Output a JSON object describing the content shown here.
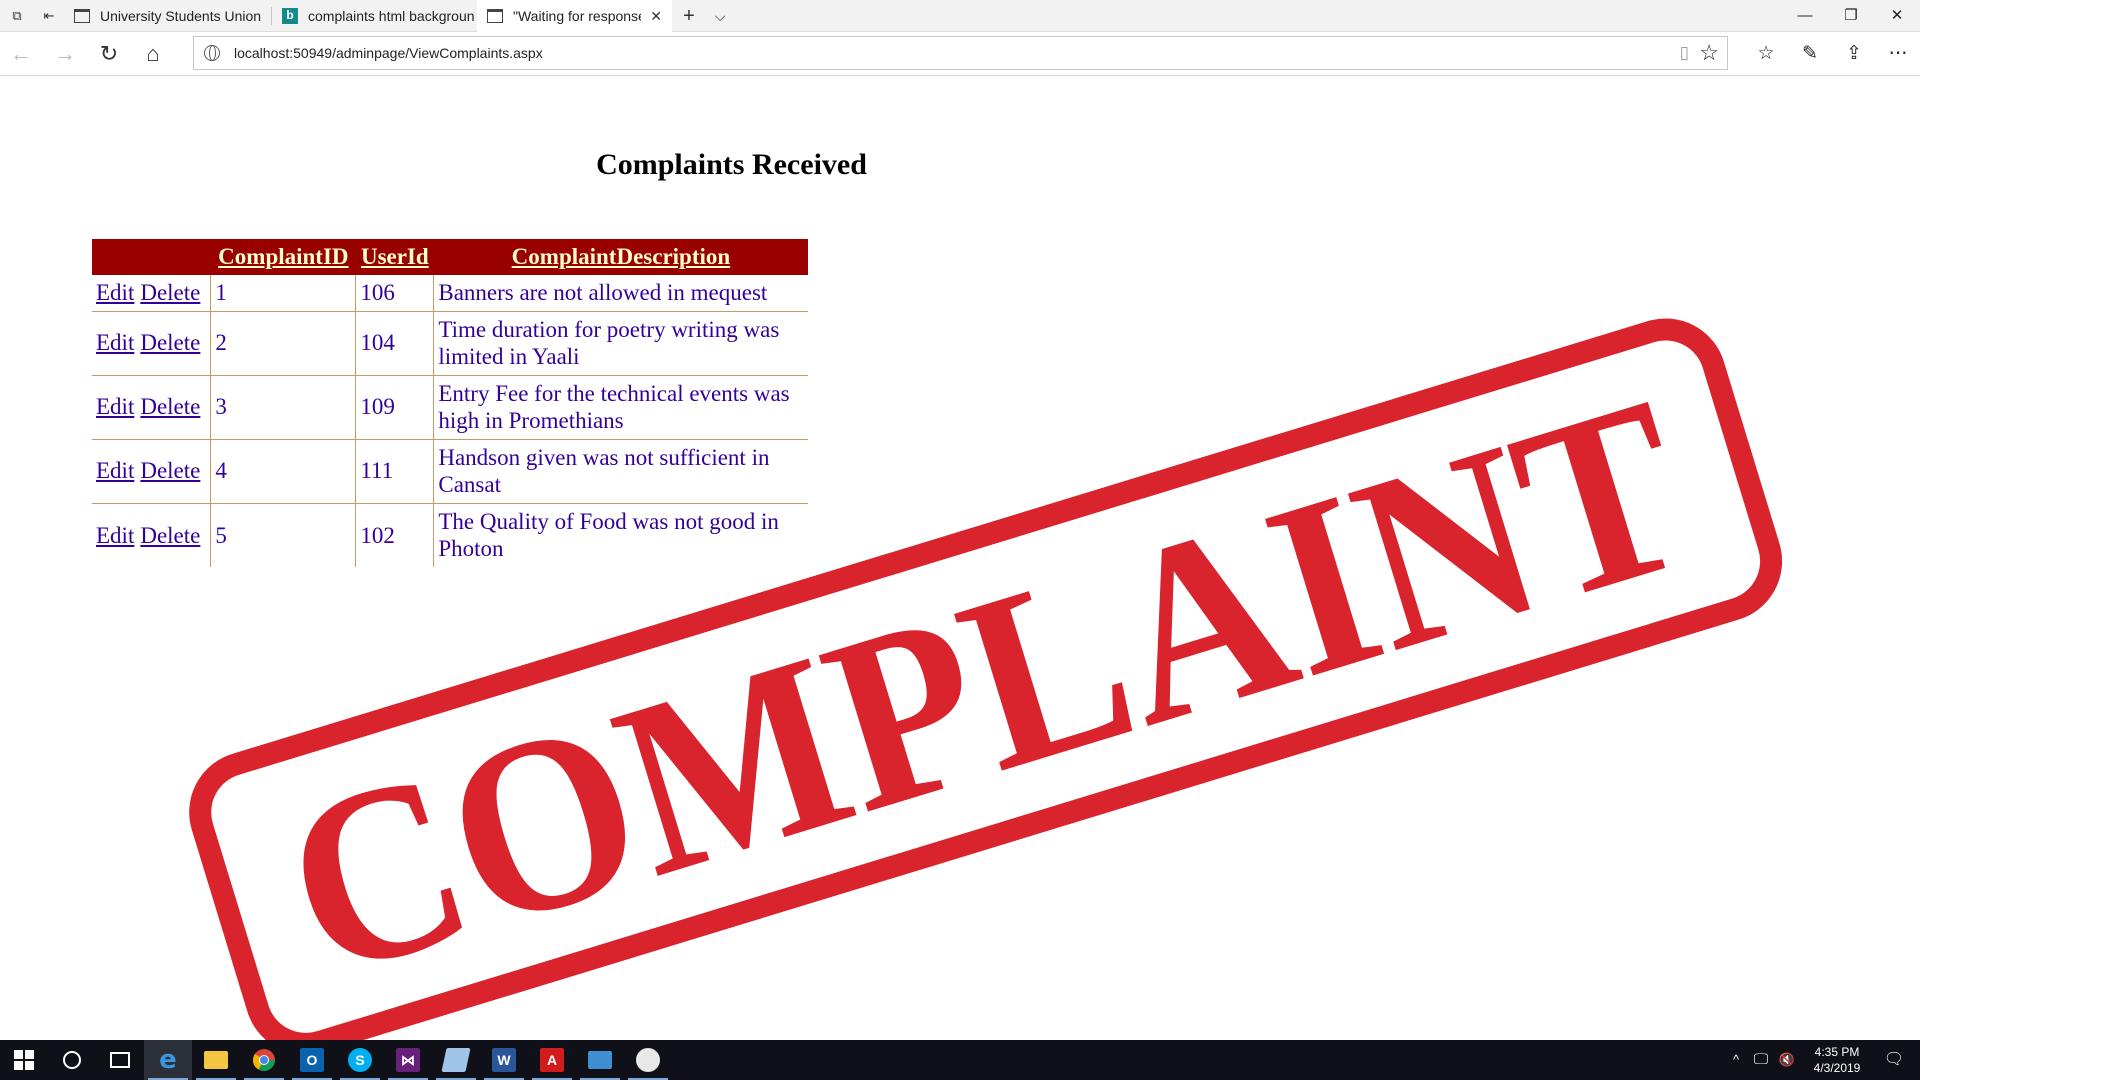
{
  "browser": {
    "tabs": [
      {
        "title": "University Students Union",
        "icon": "page-icon",
        "active": false
      },
      {
        "title": "complaints html backgroun",
        "icon": "bing-icon",
        "active": false
      },
      {
        "title": "\"Waiting for response fr",
        "icon": "page-icon",
        "active": true
      }
    ],
    "new_tab_symbol": "+",
    "tab_list_symbol": "⌵",
    "window_controls": {
      "minimize": "—",
      "restore": "❐",
      "close": "✕"
    },
    "url": "localhost:50949/adminpage/ViewComplaints.aspx",
    "bing_glyph": "b"
  },
  "page": {
    "title": "Complaints Received",
    "watermark_text": "COMPLAINT",
    "table": {
      "headers": {
        "id": "ComplaintID",
        "user": "UserId",
        "description": "ComplaintDescription"
      },
      "edit_label": "Edit",
      "delete_label": "Delete",
      "rows": [
        {
          "id": "1",
          "user": "106",
          "description": "Banners are not allowed in mequest"
        },
        {
          "id": "2",
          "user": "104",
          "description": "Time duration for poetry writing was limited in Yaali"
        },
        {
          "id": "3",
          "user": "109",
          "description": "Entry Fee for the technical events was high in Promethians"
        },
        {
          "id": "4",
          "user": "111",
          "description": "Handson given was not sufficient in Cansat"
        },
        {
          "id": "5",
          "user": "102",
          "description": "The Quality of Food was not good in Photon"
        }
      ]
    },
    "colors": {
      "header_bg": "#990000",
      "header_text": "#ffffcc",
      "cell_text": "#330099",
      "stamp_red": "#d9232d"
    }
  },
  "taskbar": {
    "time": "4:35 PM",
    "date": "4/3/2019",
    "apps": [
      "windows-start-icon",
      "cortana-search-icon",
      "task-view-icon",
      "edge-icon",
      "file-explorer-icon",
      "chrome-icon",
      "outlook-icon",
      "skype-icon",
      "visual-studio-icon",
      "notepad-icon",
      "word-icon",
      "acrobat-icon",
      "control-panel-icon",
      "paint-icon"
    ]
  }
}
